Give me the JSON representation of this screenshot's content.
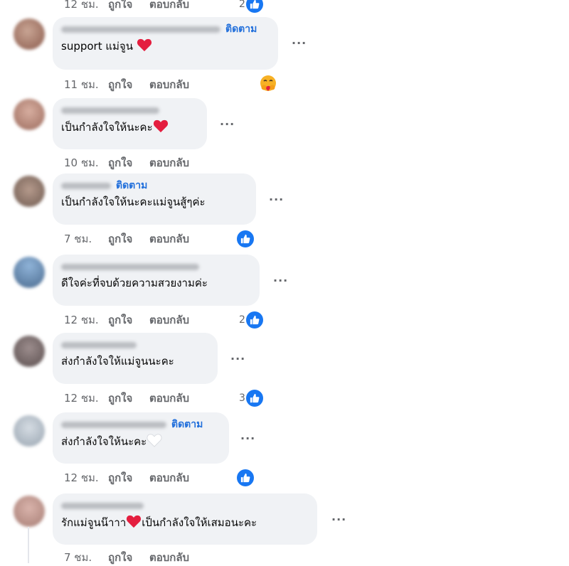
{
  "comments": [
    {
      "time": "12 ชม.",
      "like_label": "ถูกใจ",
      "reply_label": "ตอบกลับ",
      "reaction_count": "2",
      "reaction": "like"
    },
    {
      "follow_label": "ติดตาม",
      "text": "support แม่จูน",
      "emoji": "red-heart",
      "time": "11 ชม.",
      "like_label": "ถูกใจ",
      "reply_label": "ตอบกลับ",
      "reaction": "care"
    },
    {
      "text": "เป็นกำลังใจให้นะคะ",
      "emoji": "red-heart",
      "time": "10 ชม.",
      "like_label": "ถูกใจ",
      "reply_label": "ตอบกลับ"
    },
    {
      "follow_label": "ติดตาม",
      "text": "เป็นกำลังใจให้นะคะแม่จูนสู้ๆค่ะ",
      "time": "7 ชม.",
      "like_label": "ถูกใจ",
      "reply_label": "ตอบกลับ",
      "reaction": "like"
    },
    {
      "text": "ดีใจค่ะที่จบด้วยความสวยงามค่ะ",
      "time": "12 ชม.",
      "like_label": "ถูกใจ",
      "reply_label": "ตอบกลับ",
      "reaction_count": "2",
      "reaction": "like"
    },
    {
      "text": "ส่งกำลังใจให้แม่จูนนะคะ",
      "time": "12 ชม.",
      "like_label": "ถูกใจ",
      "reply_label": "ตอบกลับ",
      "reaction_count": "3",
      "reaction": "like"
    },
    {
      "follow_label": "ติดตาม",
      "text": "ส่งกำลังใจให้นะคะ",
      "emoji": "white-heart",
      "time": "12 ชม.",
      "like_label": "ถูกใจ",
      "reply_label": "ตอบกลับ",
      "reaction": "like"
    },
    {
      "text": "รักแม่จูนน๊าาา",
      "emoji": "red-heart",
      "text_after": "เป็นกำลังใจให้เสมอนะคะ",
      "time": "7 ชม.",
      "like_label": "ถูกใจ",
      "reply_label": "ตอบกลับ"
    }
  ],
  "colors": {
    "bubble": "#f0f2f5",
    "follow": "#216fdb",
    "meta": "#65676b",
    "like_badge": "#1877f2",
    "heart_red": "#e41e3f"
  }
}
